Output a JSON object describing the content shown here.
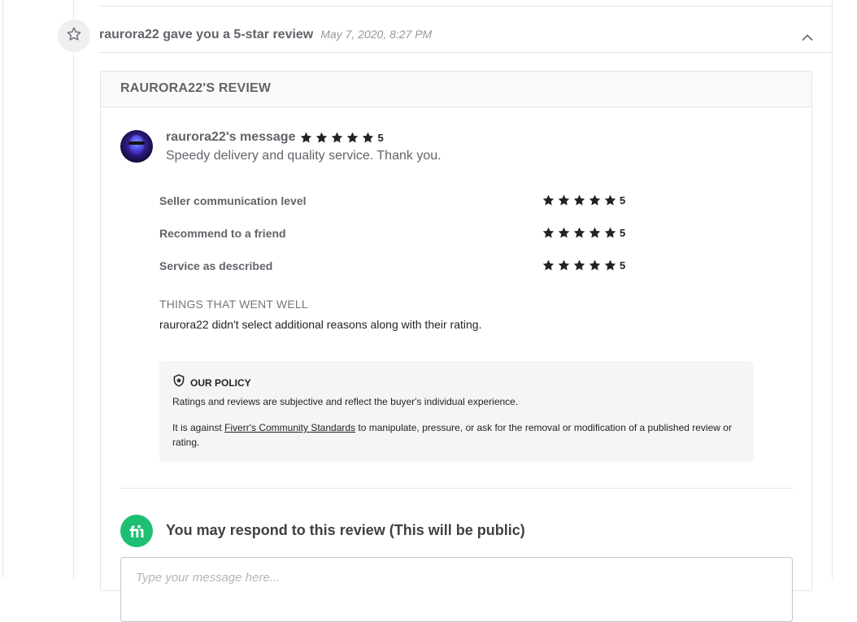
{
  "event": {
    "title": "raurora22 gave you a 5-star review",
    "timestamp": "May 7, 2020, 8:27 PM",
    "icon": "star-outline-icon",
    "toggle_icon": "chevron-up-icon"
  },
  "review": {
    "header": "RAURORA22'S REVIEW",
    "message_author": "raurora22's message",
    "overall_rating": "5",
    "overall_stars": 5,
    "message": "Speedy delivery and quality service. Thank you.",
    "criteria": [
      {
        "label": "Seller communication level",
        "rating": "5",
        "stars": 5
      },
      {
        "label": "Recommend to a friend",
        "rating": "5",
        "stars": 5
      },
      {
        "label": "Service as described",
        "rating": "5",
        "stars": 5
      }
    ],
    "things_title": "THINGS THAT WENT WELL",
    "things_text": "raurora22 didn't select additional reasons along with their rating."
  },
  "policy": {
    "title": "OUR POLICY",
    "icon": "shield-star-icon",
    "text1": "Ratings and reviews are subjective and reflect the buyer's individual experience.",
    "text2_before": "It is against ",
    "link": "Fiverr's Community Standards",
    "text2_after": " to manipulate, pressure, or ask for the removal or modification of a published review or rating."
  },
  "respond": {
    "logo_icon": "fiverr-logo-icon",
    "title": "You may respond to this review (This will be public)",
    "placeholder": "Type your message here..."
  },
  "colors": {
    "brand_green": "#1dbf73",
    "star": "#222325",
    "text_gray": "#62646a"
  }
}
